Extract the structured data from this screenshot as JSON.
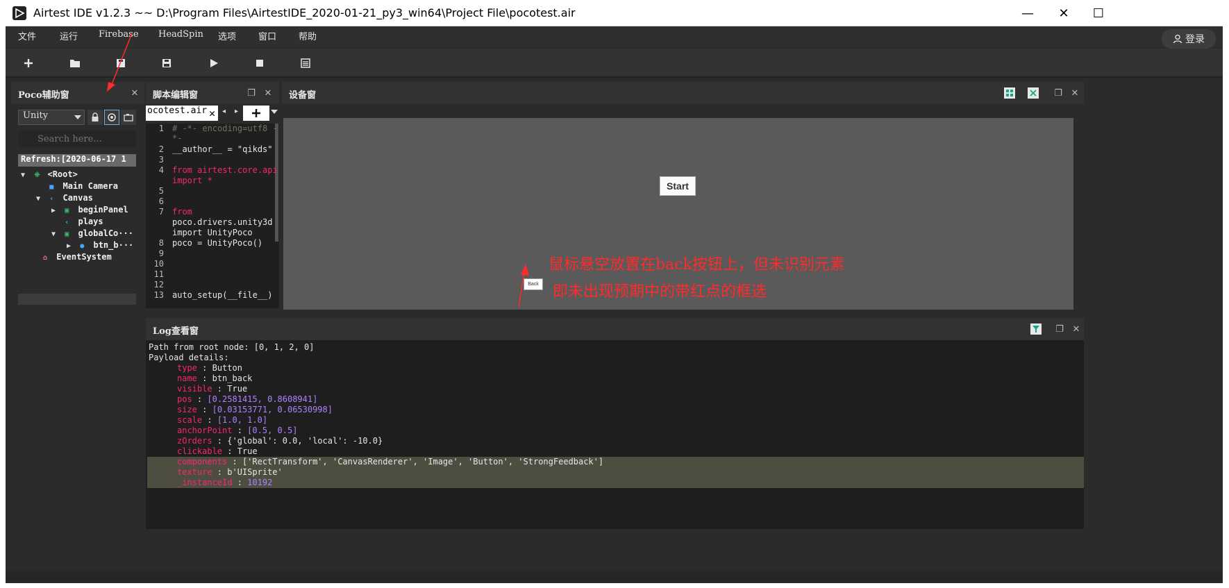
{
  "window": {
    "title": "Airtest IDE v1.2.3 ~~ D:\\Program Files\\AirtestIDE_2020-01-21_py3_win64\\Project File\\pocotest.air",
    "minimize_label": "—",
    "maximize_label": "☐",
    "close_label": "✕"
  },
  "menubar": {
    "items": [
      "文件",
      "运行",
      "Firebase",
      "HeadSpin",
      "选项",
      "窗口",
      "帮助"
    ],
    "login_label": "登录"
  },
  "toolbar": {
    "buttons": [
      "new-icon",
      "open-icon",
      "save-icon",
      "save-as-icon",
      "run-icon",
      "stop-icon",
      "log-icon"
    ]
  },
  "poco": {
    "title": "Poco辅助窗",
    "mode_value": "Unity",
    "search_placeholder": "Search here...",
    "refresh_text": "Refresh:[2020-06-17 1",
    "tree": [
      {
        "label": "<Root>",
        "toggle": "▼",
        "depth": 0
      },
      {
        "label": "Main Camera",
        "toggle": "",
        "depth": 1
      },
      {
        "label": "Canvas",
        "toggle": "▼",
        "depth": 1
      },
      {
        "label": "beginPanel",
        "toggle": "▶",
        "depth": 2
      },
      {
        "label": "plays",
        "toggle": "",
        "depth": 2
      },
      {
        "label": "globalCo···",
        "toggle": "▼",
        "depth": 2
      },
      {
        "label": "btn_b···",
        "toggle": "▶",
        "depth": 3
      },
      {
        "label": "EventSystem",
        "toggle": "",
        "depth": 1
      }
    ]
  },
  "editor": {
    "title": "脚本编辑窗",
    "tab_label": "ocotest.air",
    "lines": [
      {
        "n": "1",
        "t": "# -*- encoding=utf8 -"
      },
      {
        "n": "",
        "t": "*-"
      },
      {
        "n": "2",
        "t": "__author__ = \"qikds\""
      },
      {
        "n": "3",
        "t": ""
      },
      {
        "n": "4",
        "t": "from airtest.core.api"
      },
      {
        "n": "",
        "t": "import *"
      },
      {
        "n": "5",
        "t": ""
      },
      {
        "n": "6",
        "t": ""
      },
      {
        "n": "7",
        "t": "from"
      },
      {
        "n": "",
        "t": "poco.drivers.unity3d"
      },
      {
        "n": "",
        "t": "import UnityPoco"
      },
      {
        "n": "8",
        "t": "poco = UnityPoco()"
      },
      {
        "n": "9",
        "t": ""
      },
      {
        "n": "10",
        "t": ""
      },
      {
        "n": "11",
        "t": ""
      },
      {
        "n": "12",
        "t": ""
      },
      {
        "n": "13",
        "t": "auto_setup(__file__)"
      }
    ]
  },
  "device": {
    "title": "设备窗",
    "start_label": "Start",
    "back_label": "Back"
  },
  "annotation": {
    "line1": "鼠标悬空放置在back按钮上，但未识别元素",
    "line2": "即未出现预期中的带红点的框选"
  },
  "log": {
    "title": "Log查看窗",
    "path_line": "Path from root node: [0, 1, 2, 0]",
    "payload_line": "Payload details:",
    "entries": [
      {
        "key": "type",
        "value": "Button"
      },
      {
        "key": "name",
        "value": "btn_back"
      },
      {
        "key": "visible",
        "value": "True"
      },
      {
        "key": "pos",
        "value": "[0.2581415, 0.8608941]"
      },
      {
        "key": "size",
        "value": "[0.03153771, 0.06530998]"
      },
      {
        "key": "scale",
        "value": "[1.0, 1.0]"
      },
      {
        "key": "anchorPoint",
        "value": "[0.5, 0.5]"
      },
      {
        "key": "zOrders",
        "value": "{'global': 0.0, 'local': -10.0}"
      },
      {
        "key": "clickable",
        "value": "True"
      },
      {
        "key": "components",
        "value": "['RectTransform', 'CanvasRenderer', 'Image', 'Button', 'StrongFeedback']"
      },
      {
        "key": "texture",
        "value": "b'UISprite'"
      },
      {
        "key": "_instanceId",
        "value": "10192"
      }
    ]
  }
}
